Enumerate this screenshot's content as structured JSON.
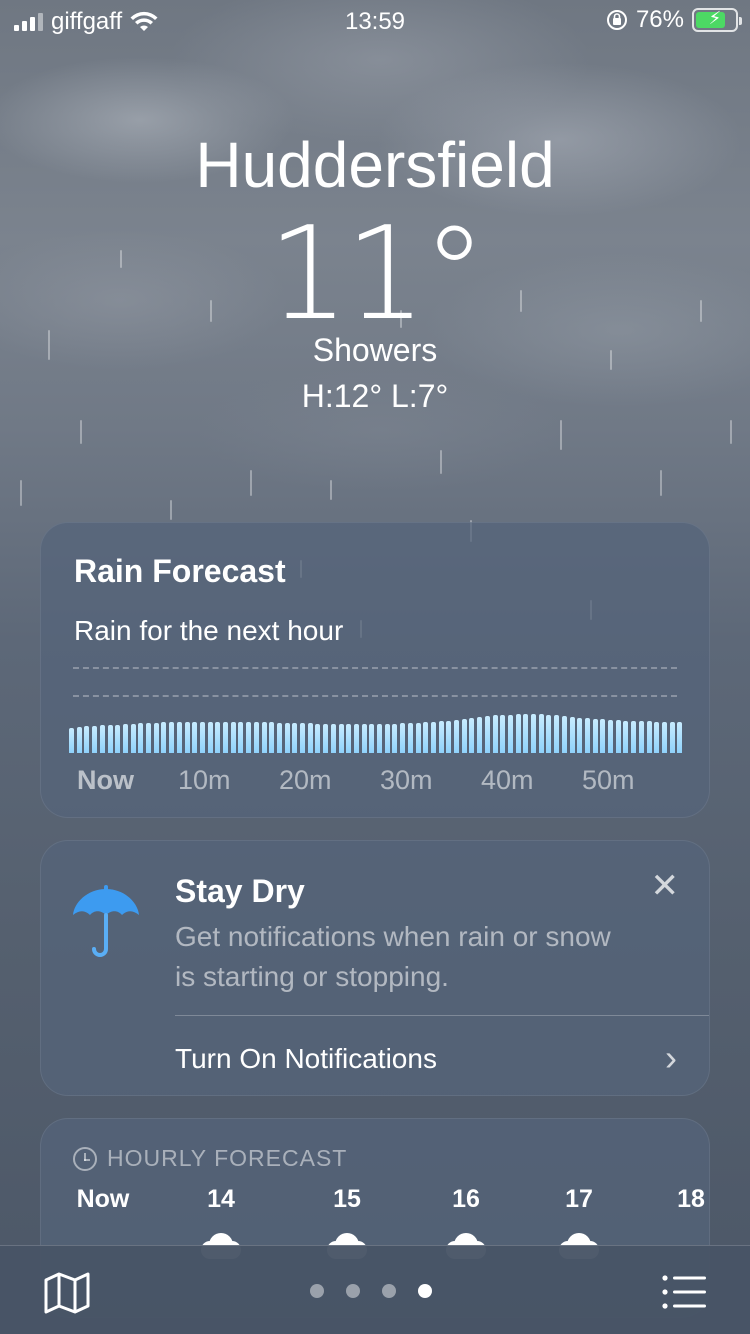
{
  "status_bar": {
    "carrier": "giffgaff",
    "time": "13:59",
    "battery_percent": "76%",
    "signal_bars": 4,
    "signal_bars_filled": 3
  },
  "location": {
    "city": "Huddersfield",
    "temperature": "11°",
    "condition": "Showers",
    "high_low": "H:12°  L:7°"
  },
  "rain_forecast": {
    "title": "Rain Forecast",
    "subtitle": "Rain for the next hour",
    "axis_labels": [
      "Now",
      "10m",
      "20m",
      "30m",
      "40m",
      "50m"
    ],
    "intensity": [
      0.5,
      0.52,
      0.53,
      0.54,
      0.55,
      0.56,
      0.57,
      0.58,
      0.58,
      0.59,
      0.6,
      0.6,
      0.61,
      0.61,
      0.62,
      0.62,
      0.62,
      0.62,
      0.62,
      0.62,
      0.62,
      0.62,
      0.62,
      0.62,
      0.62,
      0.61,
      0.61,
      0.6,
      0.6,
      0.6,
      0.59,
      0.59,
      0.58,
      0.58,
      0.58,
      0.58,
      0.58,
      0.58,
      0.58,
      0.58,
      0.58,
      0.58,
      0.58,
      0.59,
      0.6,
      0.6,
      0.61,
      0.62,
      0.63,
      0.64,
      0.66,
      0.68,
      0.7,
      0.72,
      0.74,
      0.75,
      0.76,
      0.76,
      0.77,
      0.77,
      0.77,
      0.77,
      0.76,
      0.75,
      0.74,
      0.72,
      0.7,
      0.69,
      0.68,
      0.67,
      0.66,
      0.65,
      0.64,
      0.64,
      0.63,
      0.63,
      0.62,
      0.62,
      0.62,
      0.62
    ],
    "bar_color": "#9ad8fb"
  },
  "stay_dry": {
    "icon": "umbrella-icon",
    "title": "Stay Dry",
    "body": "Get notifications when rain or snow is starting or stopping.",
    "action": "Turn On Notifications",
    "close_icon": "close-icon",
    "accent_color": "#3d9bf0"
  },
  "hourly": {
    "header": "HOURLY FORECAST",
    "hours": [
      "Now",
      "14",
      "15",
      "16",
      "17",
      "18"
    ],
    "icon": "cloud-icon"
  },
  "tab_bar": {
    "left_icon": "map-icon",
    "right_icon": "list-icon",
    "page_count": 4,
    "active_page": 4
  }
}
